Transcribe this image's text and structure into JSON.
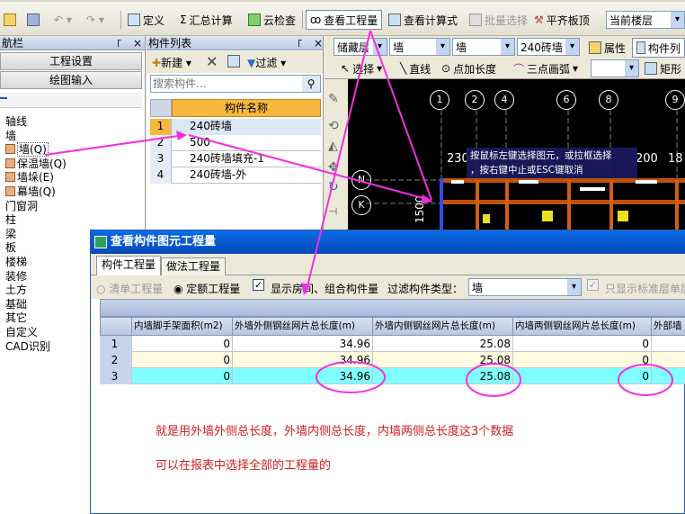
{
  "toolbar": {
    "items": {
      "define": "定义",
      "calc": "汇总计算",
      "cloud_check": "云检查",
      "view_qty": "查看工程量",
      "view_formula": "查看计算式",
      "batch_select": "批量选择",
      "level_slab": "平齐板顶",
      "current_floor": "当前楼层"
    },
    "row2": {
      "floor": "储藏层",
      "type1": "墙",
      "type2": "墙",
      "component": "240砖墙",
      "props": "属性",
      "comp_list": "构件列",
      "select": "选择",
      "line": "直线",
      "point_len": "点加长度",
      "arc": "三点画弧",
      "rect": "矩形"
    }
  },
  "nav": {
    "title": "航栏",
    "btn_settings": "工程设置",
    "btn_draw": "绘图输入",
    "tree": [
      {
        "label": "轴线",
        "level": 0
      },
      {
        "label": "墙",
        "level": 0
      },
      {
        "label": "墙(Q)",
        "level": 1
      },
      {
        "label": "保温墙(Q)",
        "level": 1
      },
      {
        "label": "墙垛(E)",
        "level": 1
      },
      {
        "label": "幕墙(Q)",
        "level": 1
      },
      {
        "label": "门窗洞",
        "level": 0
      },
      {
        "label": "柱",
        "level": 0
      },
      {
        "label": "梁",
        "level": 0
      },
      {
        "label": "板",
        "level": 0
      },
      {
        "label": "楼梯",
        "level": 0
      },
      {
        "label": "装修",
        "level": 0
      },
      {
        "label": "土方",
        "level": 0
      },
      {
        "label": "基础",
        "level": 0
      },
      {
        "label": "其它",
        "level": 0
      },
      {
        "label": "自定义",
        "level": 0
      },
      {
        "label": "CAD识别",
        "level": 0
      }
    ]
  },
  "components": {
    "title": "构件列表",
    "new": "新建",
    "filter": "过滤",
    "search_placeholder": "搜索构件...",
    "col_header": "构件名称",
    "rows": [
      {
        "idx": "1",
        "name": "240砖墙"
      },
      {
        "idx": "2",
        "name": "500"
      },
      {
        "idx": "3",
        "name": "240砖墙填充-1"
      },
      {
        "idx": "4",
        "name": "240砖墙-外"
      }
    ]
  },
  "cad": {
    "axes": [
      "1",
      "2",
      "4",
      "6",
      "8",
      "9"
    ],
    "labels": {
      "l230": "230",
      "l200": "200",
      "l18": "18",
      "l1500": "1500",
      "n": "N",
      "k": "K"
    },
    "tooltip": "按鼠标左键选择图元，或拉框选择\n，按右键中止或ESC键取消"
  },
  "dialog": {
    "title": "查看构件图元工程量",
    "tab_comp": "构件工程量",
    "tab_method": "做法工程量",
    "opt_list": "清单工程量",
    "opt_quota": "定额工程量",
    "opt_show_room": "显示房间、组合构件量",
    "filter_label": "过滤构件类型：",
    "filter_value": "墙",
    "opt_std_floor": "只显示标准层单层",
    "headers": [
      "内墙脚手架面积(m2)",
      "外墙外侧钢丝网片总长度(m)",
      "外墙内侧钢丝网片总长度(m)",
      "内墙两侧钢丝网片总长度(m)",
      "外部墙"
    ],
    "rows": [
      {
        "idx": "1",
        "v": [
          "0",
          "34.96",
          "25.08",
          "0"
        ]
      },
      {
        "idx": "2",
        "v": [
          "0",
          "34.96",
          "25.08",
          "0"
        ]
      },
      {
        "idx": "3",
        "v": [
          "0",
          "34.96",
          "25.08",
          "0"
        ]
      }
    ],
    "notes": [
      "就是用外墙外侧总长度，外墙内侧总长度，内墙两侧总长度这3个数据",
      "可以在报表中选择全部的工程量的"
    ]
  }
}
